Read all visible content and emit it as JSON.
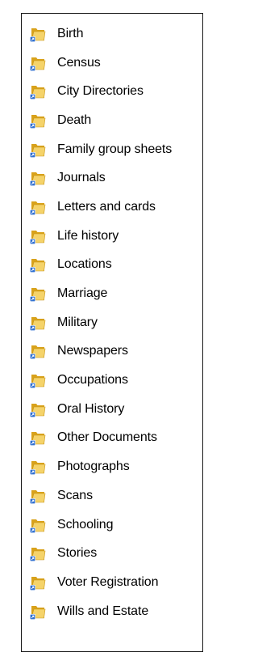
{
  "folders": [
    {
      "label": "Birth",
      "icon": "folder-icon"
    },
    {
      "label": "Census",
      "icon": "folder-icon"
    },
    {
      "label": "City Directories",
      "icon": "folder-icon"
    },
    {
      "label": "Death",
      "icon": "folder-icon"
    },
    {
      "label": "Family group sheets",
      "icon": "folder-icon"
    },
    {
      "label": "Journals",
      "icon": "folder-icon"
    },
    {
      "label": "Letters and cards",
      "icon": "folder-icon"
    },
    {
      "label": "Life history",
      "icon": "folder-icon"
    },
    {
      "label": "Locations",
      "icon": "folder-icon"
    },
    {
      "label": "Marriage",
      "icon": "folder-icon"
    },
    {
      "label": "Military",
      "icon": "folder-icon"
    },
    {
      "label": "Newspapers",
      "icon": "folder-icon"
    },
    {
      "label": "Occupations",
      "icon": "folder-icon"
    },
    {
      "label": "Oral History",
      "icon": "folder-icon"
    },
    {
      "label": "Other Documents",
      "icon": "folder-icon"
    },
    {
      "label": "Photographs",
      "icon": "folder-icon"
    },
    {
      "label": "Scans",
      "icon": "folder-icon"
    },
    {
      "label": "Schooling",
      "icon": "folder-icon"
    },
    {
      "label": "Stories",
      "icon": "folder-icon"
    },
    {
      "label": "Voter Registration",
      "icon": "folder-icon"
    },
    {
      "label": "Wills and Estate",
      "icon": "folder-icon"
    }
  ],
  "colors": {
    "folder_back": "#d9a21b",
    "folder_front": "#f5d36a",
    "shortcut_badge": "#2f6fd0",
    "border": "#1a1a1a"
  }
}
